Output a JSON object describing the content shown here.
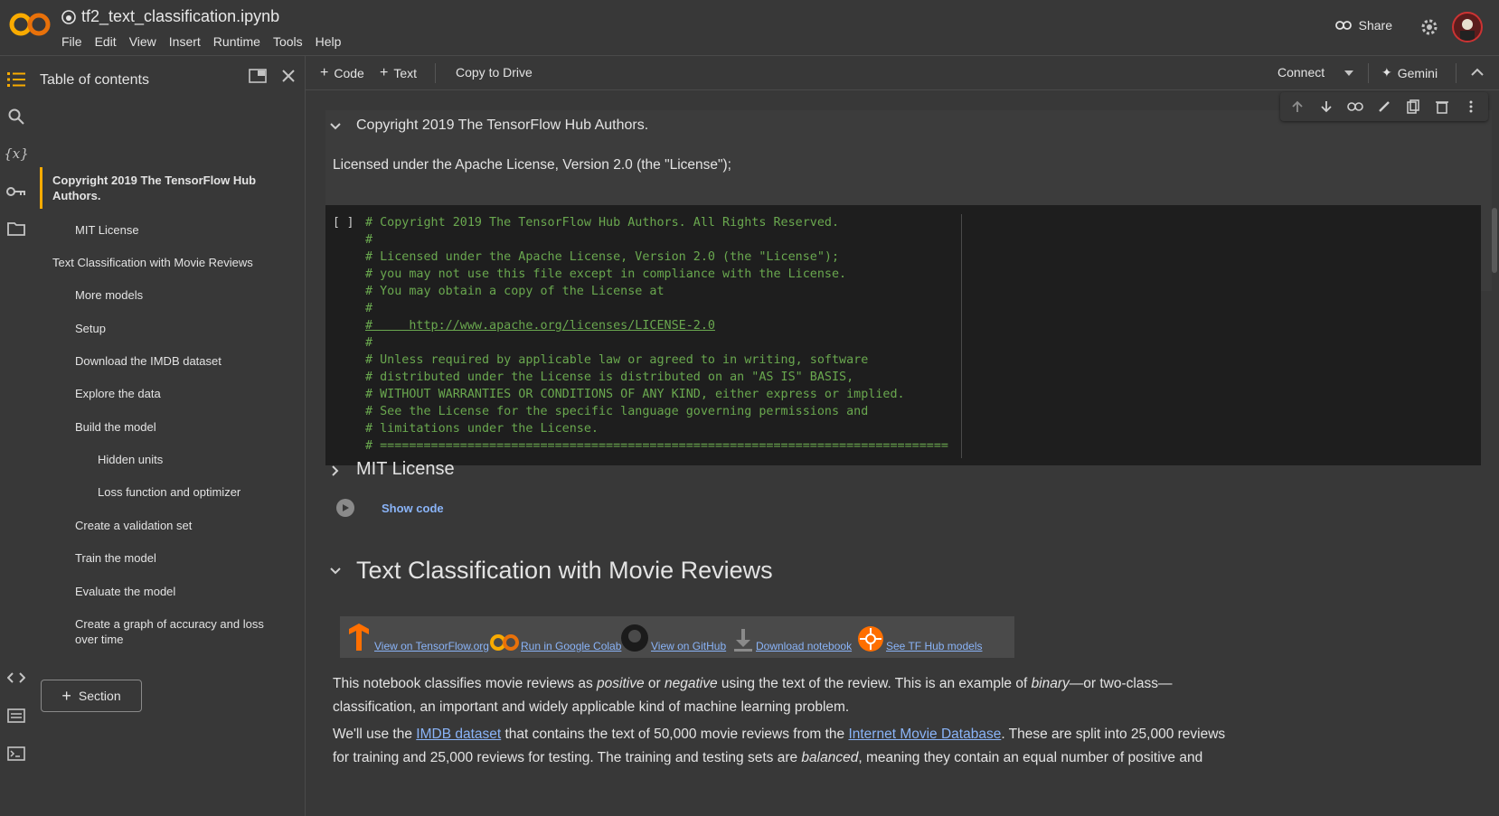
{
  "header": {
    "notebook_name": "tf2_text_classification.ipynb",
    "menu": [
      "File",
      "Edit",
      "View",
      "Insert",
      "Runtime",
      "Tools",
      "Help"
    ],
    "share_label": "Share"
  },
  "toc": {
    "title": "Table of contents",
    "items": [
      {
        "label": "Copyright 2019 The TensorFlow Hub Authors.",
        "level": 1,
        "active": true
      },
      {
        "label": "MIT License",
        "level": 2
      },
      {
        "label": "Text Classification with Movie Reviews",
        "level": 1
      },
      {
        "label": "More models",
        "level": 2
      },
      {
        "label": "Setup",
        "level": 2
      },
      {
        "label": "Download the IMDB dataset",
        "level": 2
      },
      {
        "label": "Explore the data",
        "level": 2
      },
      {
        "label": "Build the model",
        "level": 2
      },
      {
        "label": "Hidden units",
        "level": 3
      },
      {
        "label": "Loss function and optimizer",
        "level": 3
      },
      {
        "label": "Create a validation set",
        "level": 2
      },
      {
        "label": "Train the model",
        "level": 2
      },
      {
        "label": "Evaluate the model",
        "level": 2
      },
      {
        "label": "Create a graph of accuracy and loss over time",
        "level": 2
      }
    ],
    "section_button": "Section"
  },
  "toolbar": {
    "code_label": "Code",
    "text_label": "Text",
    "copy_label": "Copy to Drive",
    "connect_label": "Connect",
    "gemini_label": "Gemini"
  },
  "cells": {
    "copyright_heading": "Copyright 2019 The TensorFlow Hub Authors.",
    "license_text": "Licensed under the Apache License, Version 2.0 (the \"License\");",
    "code_brackets": "[ ]",
    "code_lines": [
      "# Copyright 2019 The TensorFlow Hub Authors. All Rights Reserved.",
      "#",
      "# Licensed under the Apache License, Version 2.0 (the \"License\");",
      "# you may not use this file except in compliance with the License.",
      "# You may obtain a copy of the License at",
      "#",
      "#     http://www.apache.org/licenses/LICENSE-2.0",
      "#",
      "# Unless required by applicable law or agreed to in writing, software",
      "# distributed under the License is distributed on an \"AS IS\" BASIS,",
      "# WITHOUT WARRANTIES OR CONDITIONS OF ANY KIND, either express or implied.",
      "# See the License for the specific language governing permissions and",
      "# limitations under the License.",
      "# =============================================================================="
    ],
    "mit_heading": "MIT License",
    "show_code": "Show code",
    "tc_heading": "Text Classification with Movie Reviews",
    "badges": [
      {
        "label": "View on TensorFlow.org",
        "icon": "tensorflow-icon"
      },
      {
        "label": "Run in Google Colab",
        "icon": "colab-icon"
      },
      {
        "label": "View on GitHub",
        "icon": "github-icon"
      },
      {
        "label": "Download notebook",
        "icon": "download-icon"
      },
      {
        "label": "See TF Hub models",
        "icon": "tfhub-icon"
      }
    ],
    "para1": {
      "t1": "This notebook classifies movie reviews as ",
      "i1": "positive",
      "t2": " or ",
      "i2": "negative",
      "t3": " using the text of the review. This is an example of ",
      "i3": "binary",
      "t4": "—or two-class—classification, an important and widely applicable kind of machine learning problem."
    },
    "para2": {
      "t1": "We'll use the ",
      "link1": "IMDB dataset",
      "t2": " that contains the text of 50,000 movie reviews from the ",
      "link2": "Internet Movie Database",
      "t3": ". These are split into 25,000 reviews for training and 25,000 reviews for testing. The training and testing sets are ",
      "i1": "balanced",
      "t4": ", meaning they contain an equal number of positive and"
    }
  },
  "colors": {
    "accent": "#f9ab00",
    "link": "#8ab4f8",
    "code_comment": "#6aa84f"
  }
}
